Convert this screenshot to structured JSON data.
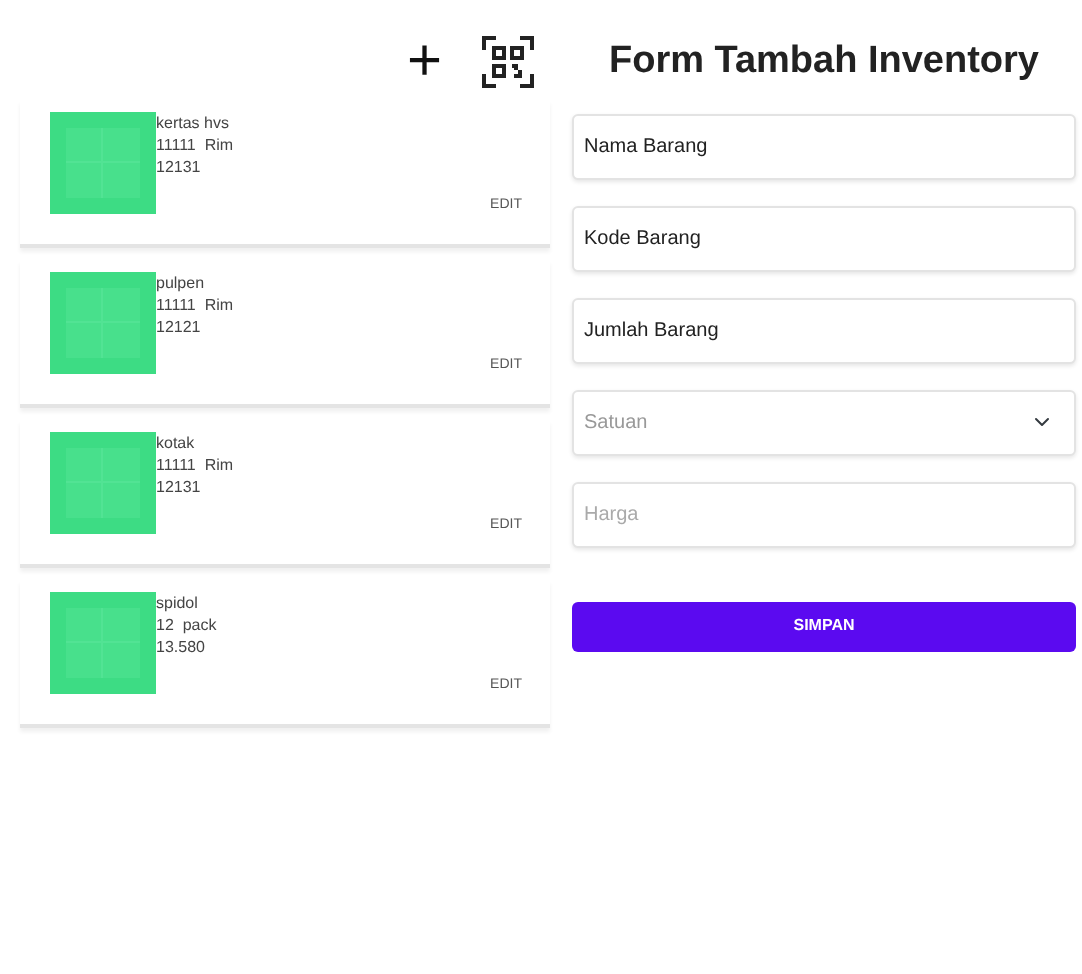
{
  "toolbar": {
    "add": "+"
  },
  "items": [
    {
      "name": "kertas hvs",
      "quantity": "11111",
      "unit": "Rim",
      "price": "12131",
      "action": "EDIT"
    },
    {
      "name": "pulpen",
      "quantity": "11111",
      "unit": "Rim",
      "price": "12121",
      "action": "EDIT"
    },
    {
      "name": "kotak",
      "quantity": "11111",
      "unit": "Rim",
      "price": "12131",
      "action": "EDIT"
    },
    {
      "name": "spidol",
      "quantity": "12",
      "unit": "pack",
      "price": "13.580",
      "action": "EDIT"
    }
  ],
  "form": {
    "title": "Form Tambah Inventory",
    "fields": [
      {
        "kind": "text",
        "value": "Nama Barang"
      },
      {
        "kind": "text",
        "value": "Kode Barang"
      },
      {
        "kind": "text",
        "value": "Jumlah Barang"
      },
      {
        "kind": "select",
        "placeholder": "Satuan"
      },
      {
        "kind": "text",
        "placeholder": "Harga"
      }
    ],
    "submit": "SIMPAN"
  }
}
